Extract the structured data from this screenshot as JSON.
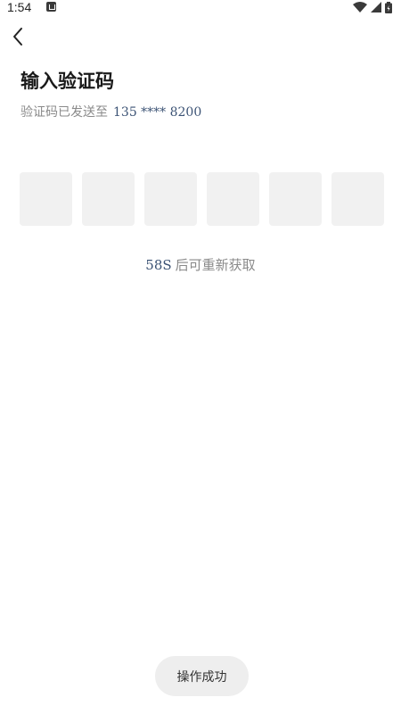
{
  "status_bar": {
    "time": "1:54",
    "icons": [
      "notification-icon",
      "wifi-icon",
      "signal-icon",
      "battery-icon"
    ]
  },
  "nav": {
    "back_icon": "chevron-left-icon"
  },
  "page": {
    "title": "输入验证码",
    "sent_label": "验证码已发送至",
    "phone": "135 **** 8200"
  },
  "code_input": {
    "length": 6,
    "values": [
      "",
      "",
      "",
      "",
      "",
      ""
    ]
  },
  "resend": {
    "countdown": "58S",
    "label": "后可重新获取"
  },
  "toast": {
    "message": "操作成功"
  },
  "colors": {
    "accent": "#3c5375",
    "box_bg": "#f1f1f1",
    "muted_text": "#8a8a8a",
    "toast_bg": "#eeeeee"
  }
}
